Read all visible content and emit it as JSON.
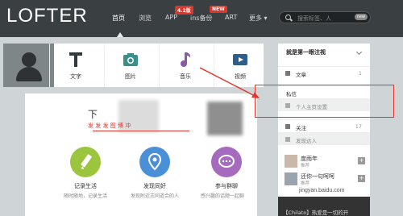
{
  "app": {
    "logo": "LOFTER"
  },
  "nav": {
    "items": [
      "首页",
      "浏览",
      "APP",
      "ins备份",
      "ART",
      "更多"
    ],
    "badges": [
      "4.2版",
      "NEW"
    ],
    "search_placeholder": "搜索标签、人",
    "search_badge": "new"
  },
  "post": {
    "items": [
      {
        "label": "文字",
        "icon": "text-T-icon"
      },
      {
        "label": "图片",
        "icon": "camera-icon"
      },
      {
        "label": "音乐",
        "icon": "music-note-icon"
      },
      {
        "label": "视频",
        "icon": "video-play-icon"
      }
    ]
  },
  "card": {
    "heading": "下",
    "subheading": "发 发 发 图 博 冲",
    "features": [
      {
        "title": "记录生活",
        "sub": "随时随地，记录生活",
        "icon": "pen-icon"
      },
      {
        "title": "发现同好",
        "sub": "发现附近志同道合的人",
        "icon": "location-pin-icon"
      },
      {
        "title": "参与群聊",
        "sub": "感兴趣的话题一起聊",
        "icon": "chat-bubble-icon"
      }
    ]
  },
  "sidebar": {
    "title": "就是第一眼注视",
    "rows": [
      {
        "label": "文章",
        "count": "1"
      },
      {
        "label": "私信",
        "count": ""
      },
      {
        "label": "个人主页设置",
        "count": ""
      },
      {
        "label": "关注",
        "count": "17"
      },
      {
        "label": "发现达人",
        "count": ""
      }
    ],
    "people": [
      {
        "name": "度雨年",
        "sub": "推荐"
      },
      {
        "name": "还你一句呵呵",
        "sub": "推荐"
      }
    ],
    "promo_text": "【Chilato】热爱是一切的开"
  },
  "watermark": "jingyan.baidu.com",
  "colors": {
    "topbar": "#3a3f42",
    "accent_red": "#d9382f",
    "annotation_red": "#e0362c"
  }
}
